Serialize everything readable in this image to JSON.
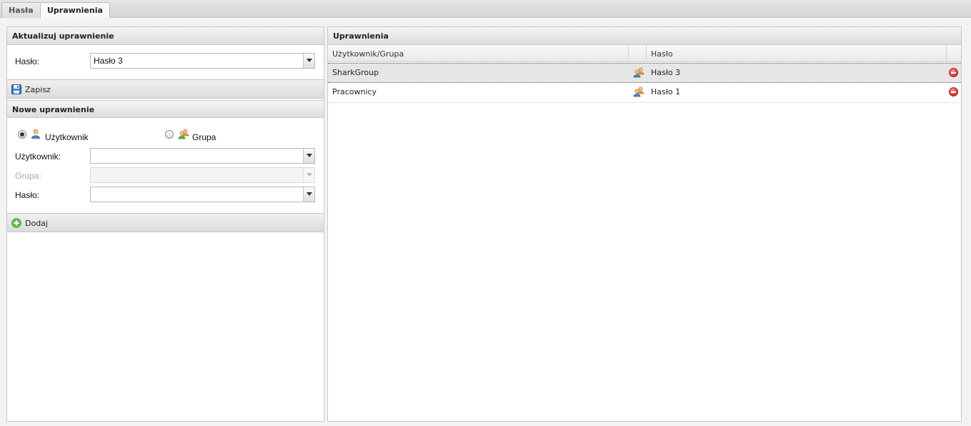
{
  "tabs": [
    {
      "label": "Hasła",
      "active": false
    },
    {
      "label": "Uprawnienia",
      "active": true
    }
  ],
  "update_panel": {
    "title": "Aktualizuj uprawnienie",
    "password_label": "Hasło:",
    "password_value": "Hasło 3",
    "save_label": "Zapisz"
  },
  "new_panel": {
    "title": "Nowe uprawnienie",
    "radio_user_label": "Użytkownik",
    "radio_group_label": "Grupa",
    "selected_radio": "user",
    "user_label": "Użytkownik:",
    "user_value": "",
    "group_label": "Grupa:",
    "group_value": "",
    "password_label": "Hasło:",
    "password_value": "",
    "add_label": "Dodaj"
  },
  "permissions_panel": {
    "title": "Uprawnienia",
    "columns": [
      "Użytkownik/Grupa",
      "",
      "Hasło",
      ""
    ],
    "rows": [
      {
        "name": "SharkGroup",
        "type_icon": "group-icon",
        "password": "Hasło 3",
        "selected": true
      },
      {
        "name": "Pracownicy",
        "type_icon": "group-icon",
        "password": "Hasło 1",
        "selected": false
      }
    ]
  },
  "icons": {
    "save": "floppy-disk-icon",
    "add": "add-circle-icon",
    "remove": "remove-circle-icon",
    "user": "user-icon",
    "group": "group-icon"
  },
  "colors": {
    "remove_red": "#d42f2f",
    "add_green": "#3e9a2e",
    "selected_row": "#e6e6e6"
  }
}
